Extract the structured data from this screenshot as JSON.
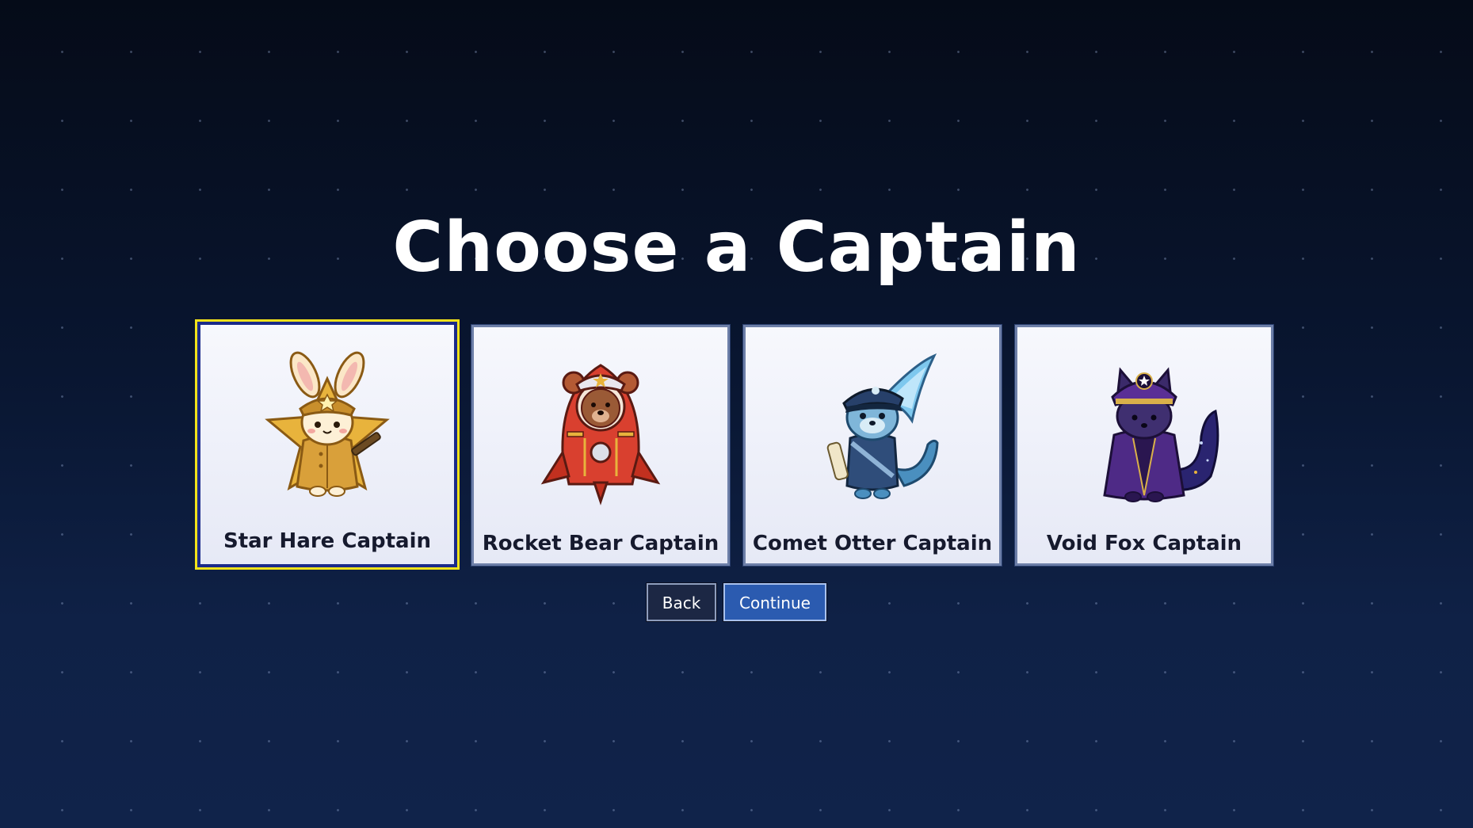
{
  "screen": {
    "title": "Choose a Captain"
  },
  "captains": [
    {
      "name": "Star Hare Captain",
      "icon": "star-hare-captain-icon",
      "selected": true
    },
    {
      "name": "Rocket Bear Captain",
      "icon": "rocket-bear-captain-icon",
      "selected": false
    },
    {
      "name": "Comet Otter Captain",
      "icon": "comet-otter-captain-icon",
      "selected": false
    },
    {
      "name": "Void Fox Captain",
      "icon": "void-fox-captain-icon",
      "selected": false
    }
  ],
  "actions": {
    "back_label": "Back",
    "continue_label": "Continue"
  },
  "colors": {
    "background_top": "#050b18",
    "background_bottom": "#10234a",
    "selection_outline": "#f2e21a",
    "continue_button": "#2b5bb0",
    "back_button": "#1c2744"
  }
}
